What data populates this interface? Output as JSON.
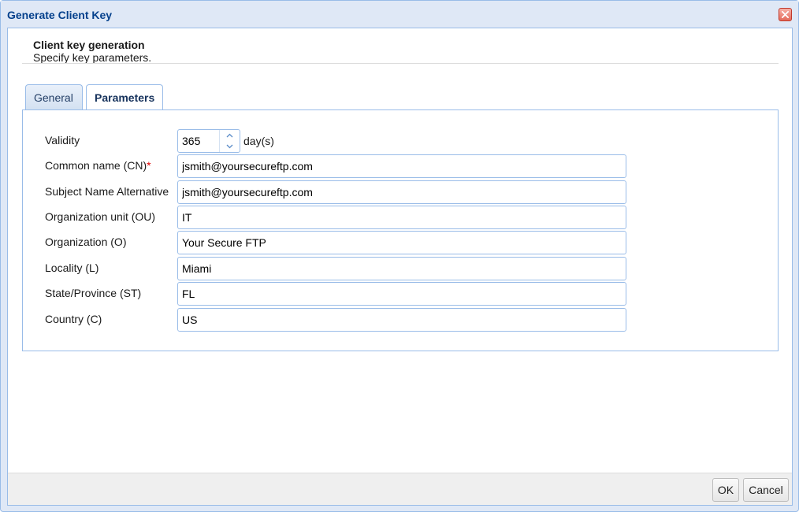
{
  "window": {
    "title": "Generate Client Key"
  },
  "header": {
    "title": "Client key generation",
    "subtitle": "Specify key parameters."
  },
  "tabs": [
    {
      "label": "General",
      "active": false
    },
    {
      "label": "Parameters",
      "active": true
    }
  ],
  "form": {
    "validity": {
      "label": "Validity",
      "value": "365",
      "unit": "day(s)"
    },
    "common_name": {
      "label": "Common name (CN)",
      "required_mark": "*",
      "value": "jsmith@yoursecureftp.com"
    },
    "subject_alt": {
      "label": "Subject Name Alternative",
      "value": "jsmith@yoursecureftp.com"
    },
    "org_unit": {
      "label": "Organization unit (OU)",
      "value": "IT"
    },
    "organization": {
      "label": "Organization (O)",
      "value": "Your Secure FTP"
    },
    "locality": {
      "label": "Locality (L)",
      "value": "Miami"
    },
    "state": {
      "label": "State/Province (ST)",
      "value": "FL"
    },
    "country": {
      "label": "Country (C)",
      "value": "US"
    }
  },
  "footer": {
    "ok_label": "OK",
    "cancel_label": "Cancel"
  },
  "colors": {
    "accent": "#99bce8",
    "title": "#04408c",
    "required": "#dd0000"
  }
}
